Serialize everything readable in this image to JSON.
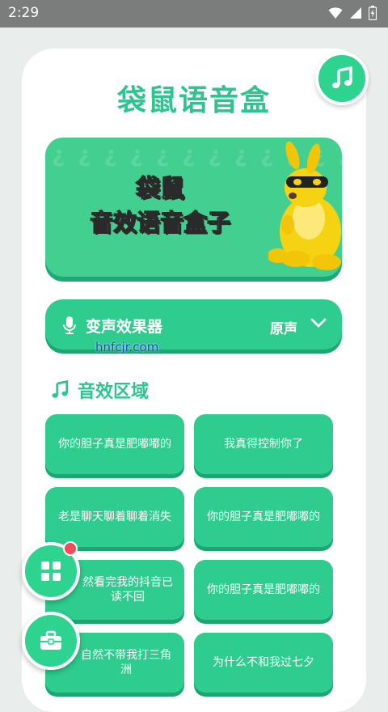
{
  "status_bar": {
    "time": "2:29"
  },
  "app": {
    "title": "袋鼠语音盒"
  },
  "banner": {
    "line1": "袋鼠",
    "line2": "音效语音盒子"
  },
  "voice_changer": {
    "label": "变声效果器",
    "value": "原声"
  },
  "watermark": "hnfcjr.com",
  "sound_section": {
    "title": "音效区域"
  },
  "sound_effects": [
    "你的胆子真是肥嘟嘟的",
    "我真得控制你了",
    "老是聊天聊着聊着消失",
    "你的胆子真是肥嘟嘟的",
    "然看完我的抖音已读不回",
    "你的胆子真是肥嘟嘟的",
    "自然不带我打三角洲",
    "为什么不和我过七夕"
  ],
  "colors": {
    "accent": "#2ecc8e",
    "title": "#2dc58f",
    "badge": "#f04c5c"
  },
  "icons": {
    "music": "music-note-icon",
    "mic": "microphone-icon",
    "dropdown": "chevron-down-icon",
    "grid": "grid-icon",
    "toolbox": "toolbox-icon"
  }
}
